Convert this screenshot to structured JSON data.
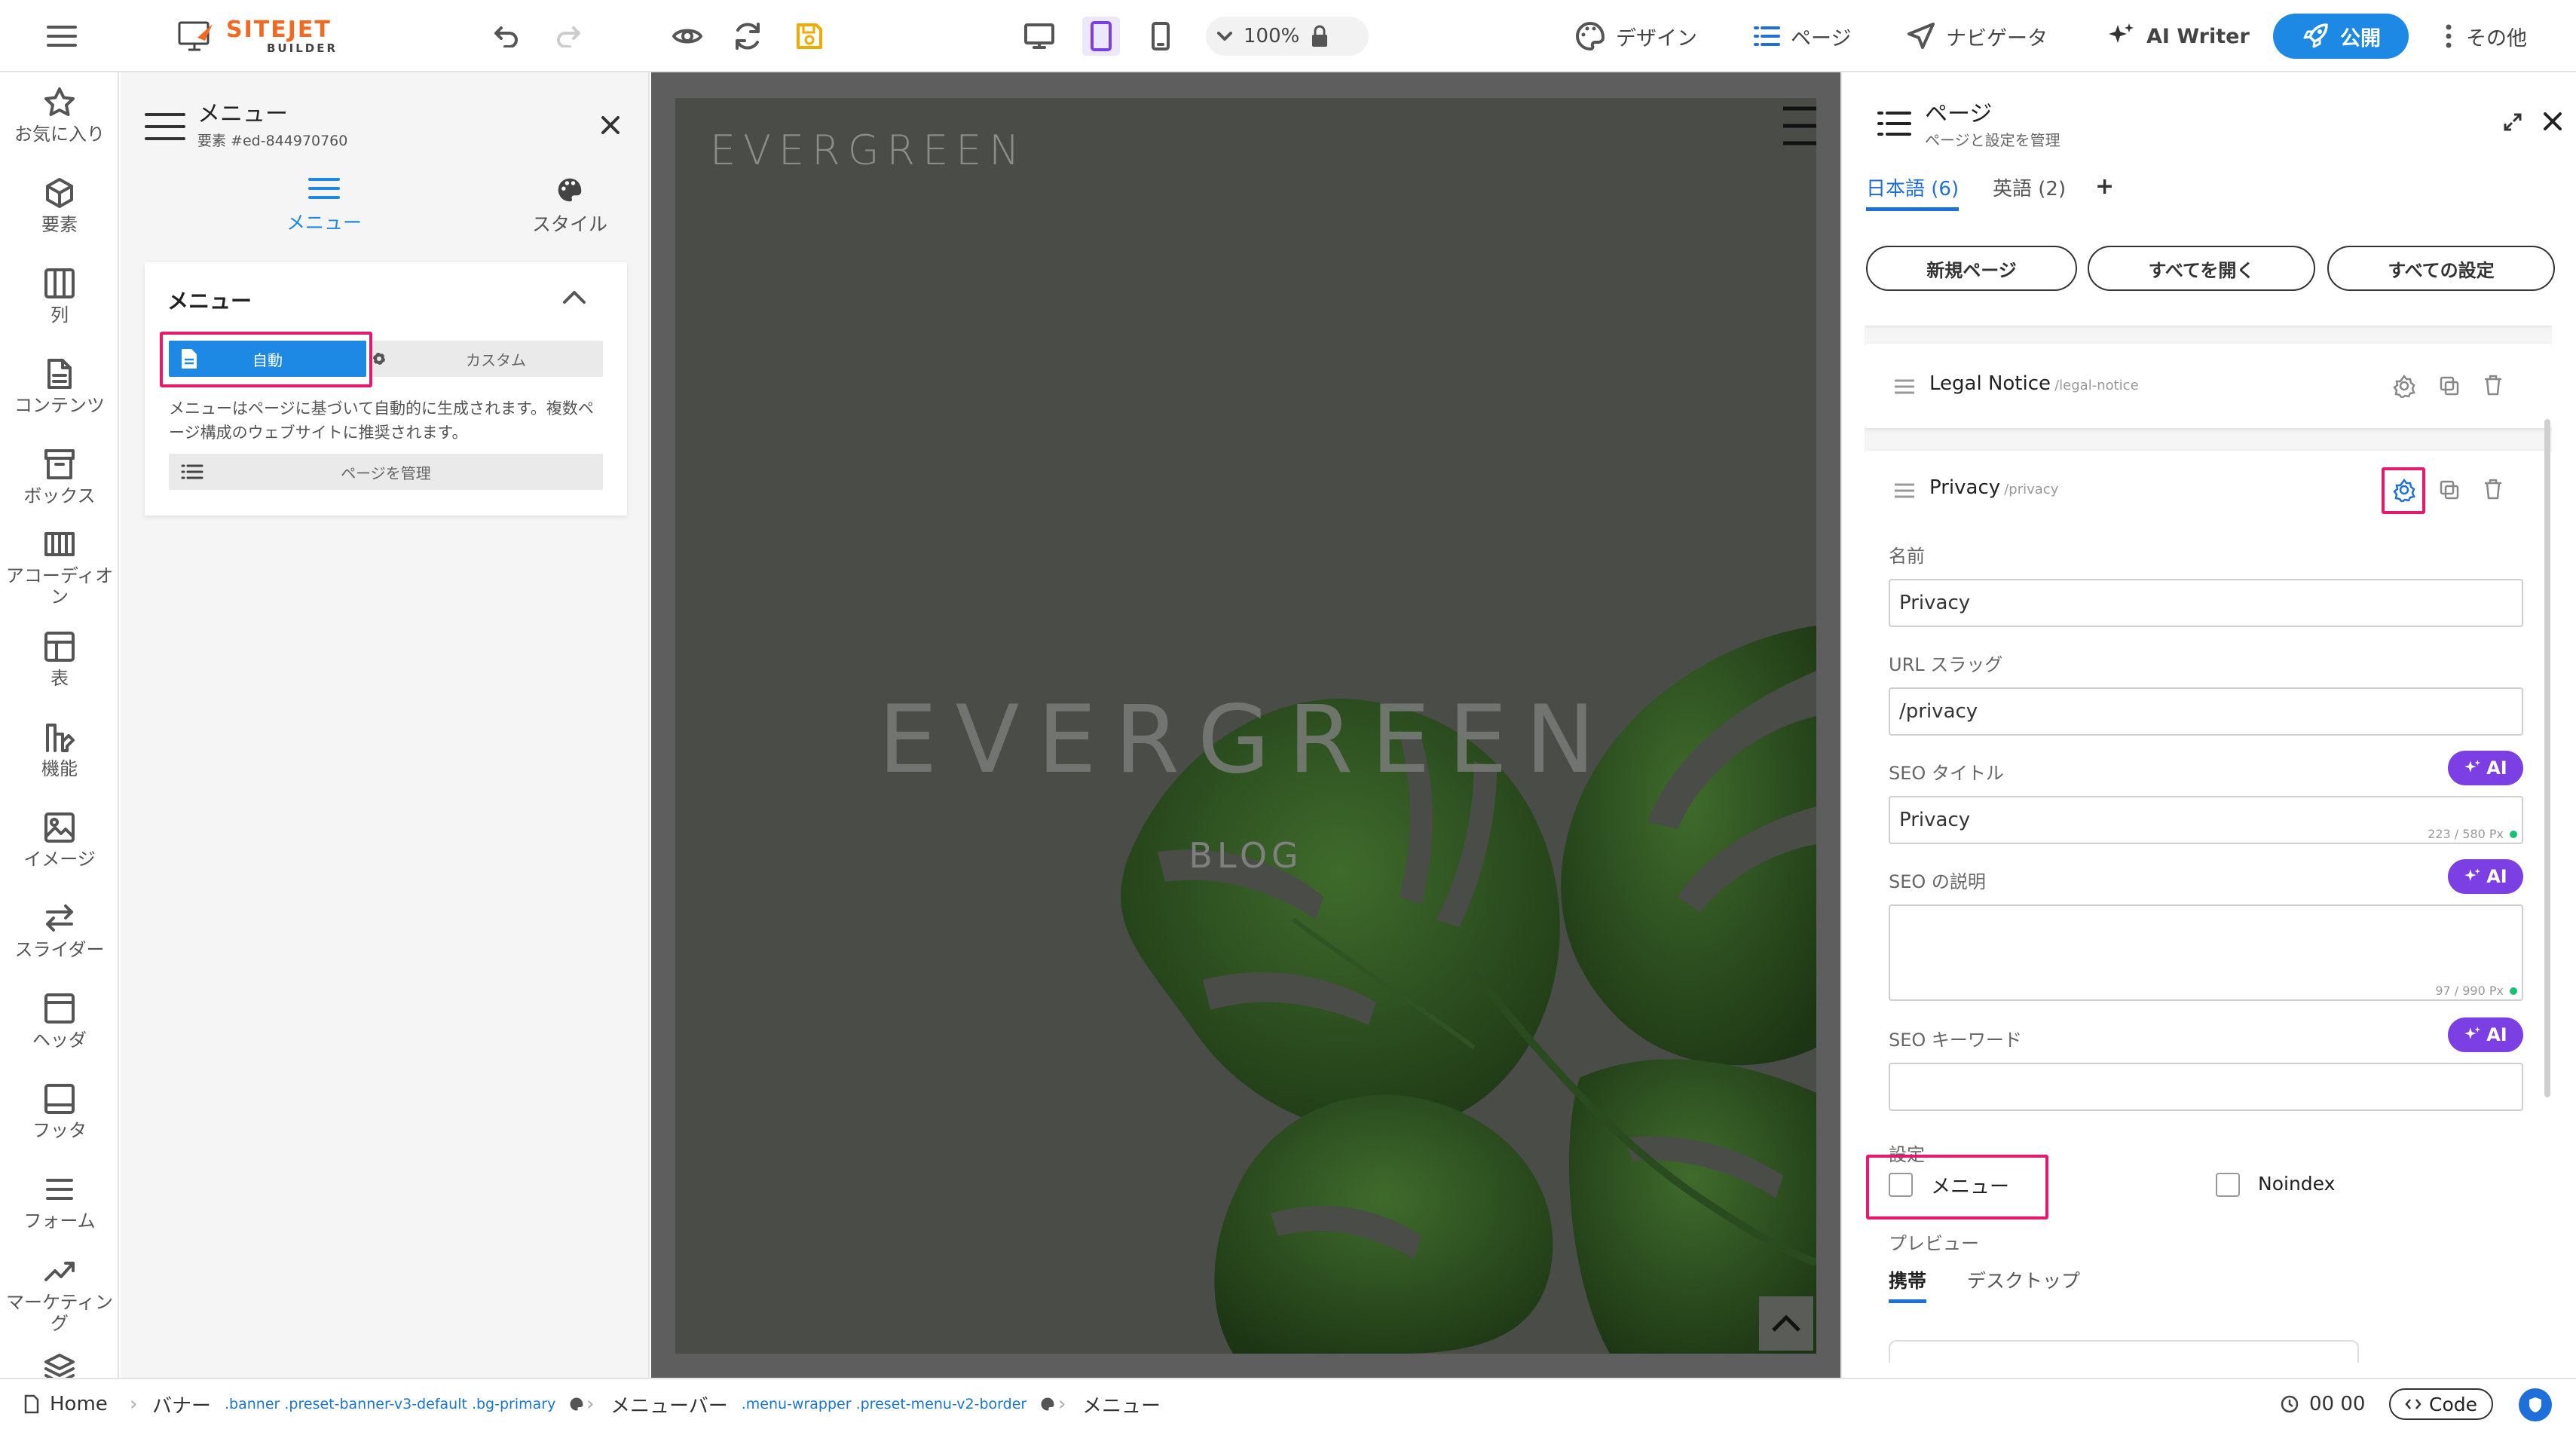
{
  "topbar": {
    "logo_main": "SITEJET",
    "logo_sub": "BUILDER",
    "zoom": "100%",
    "nav": [
      {
        "label": "デザイン",
        "icon": "palette-icon"
      },
      {
        "label": "ページ",
        "icon": "list-icon"
      },
      {
        "label": "ナビゲータ",
        "icon": "navigator-icon"
      },
      {
        "label": "AI Writer",
        "icon": "sparkle-icon"
      }
    ],
    "publish_label": "公開",
    "more_label": "その他"
  },
  "leftbar": {
    "items": [
      {
        "label": "お気に入り",
        "icon": "star-icon"
      },
      {
        "label": "要素",
        "icon": "cube-icon"
      },
      {
        "label": "列",
        "icon": "columns-icon"
      },
      {
        "label": "コンテンツ",
        "icon": "document-icon"
      },
      {
        "label": "ボックス",
        "icon": "box-icon"
      },
      {
        "label": "アコーディオン",
        "icon": "accordion-icon"
      },
      {
        "label": "表",
        "icon": "table-icon"
      },
      {
        "label": "機能",
        "icon": "features-icon"
      },
      {
        "label": "イメージ",
        "icon": "image-icon"
      },
      {
        "label": "スライダー",
        "icon": "slider-icon"
      },
      {
        "label": "ヘッダ",
        "icon": "header-icon"
      },
      {
        "label": "フッタ",
        "icon": "footer-icon"
      },
      {
        "label": "フォーム",
        "icon": "form-icon"
      },
      {
        "label": "マーケティング",
        "icon": "marketing-icon"
      }
    ]
  },
  "element_panel": {
    "title": "メニュー",
    "subtitle": "要素 #ed-844970760",
    "tabs": [
      {
        "label": "メニュー"
      },
      {
        "label": "スタイル"
      }
    ],
    "section_title": "メニュー",
    "mode_auto": "自動",
    "mode_custom": "カスタム",
    "description": "メニューはページに基づいて自動的に生成されます。複数ページ構成のウェブサイトに推奨されます。",
    "manage_pages": "ページを管理"
  },
  "canvas": {
    "site_name_small": "EVERGREEN",
    "site_name_large": "EVERGREEN",
    "tagline": "BLOG"
  },
  "pages_panel": {
    "title": "ページ",
    "subtitle": "ページと設定を管理",
    "lang_tabs": [
      {
        "label": "日本語 (6)"
      },
      {
        "label": "英語 (2)"
      }
    ],
    "buttons": {
      "new_page": "新規ページ",
      "expand_all": "すべてを開く",
      "all_settings": "すべての設定"
    },
    "pages": [
      {
        "name": "Legal Notice",
        "slug": "/legal-notice"
      },
      {
        "name": "Privacy",
        "slug": "/privacy"
      }
    ],
    "form": {
      "name_label": "名前",
      "name_value": "Privacy",
      "slug_label": "URL スラッグ",
      "slug_value": "/privacy",
      "seo_title_label": "SEO タイトル",
      "seo_title_value": "Privacy",
      "seo_title_counter": "223 / 580 Px",
      "seo_desc_label": "SEO の説明",
      "seo_desc_value": "",
      "seo_desc_counter": "97 / 990 Px",
      "seo_keywords_label": "SEO キーワード",
      "seo_keywords_value": "",
      "ai_label": "AI",
      "settings_label": "設定",
      "menu_checkbox": "メニュー",
      "noindex_checkbox": "Noindex",
      "preview_label": "プレビュー",
      "preview_tabs": [
        {
          "label": "携帯"
        },
        {
          "label": "デスクトップ"
        }
      ]
    }
  },
  "statusbar": {
    "home": "Home",
    "crumb1": "バナー",
    "crumb1_code": ".banner .preset-banner-v3-default .bg-primary",
    "crumb2": "メニューバー",
    "crumb2_code": ".menu-wrapper .preset-menu-v2-border",
    "crumb3": "メニュー",
    "timer": "00 00",
    "code_label": "Code"
  },
  "colors": {
    "accent_blue": "#1e88e5",
    "highlight_pink": "#e6196f",
    "ai_purple": "#7b3fe4",
    "logo_orange": "#f26a21"
  }
}
